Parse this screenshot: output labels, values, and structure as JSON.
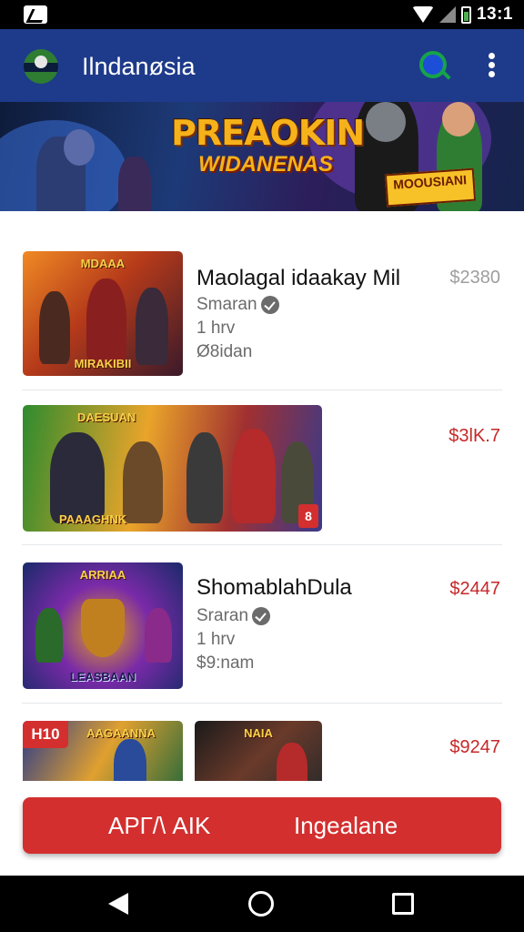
{
  "status_bar": {
    "time": "13:1",
    "icons": [
      "notification-icon",
      "wifi-icon",
      "signal-icon",
      "battery-icon"
    ]
  },
  "app_bar": {
    "title": "Ilndanøsia",
    "icons": [
      "app-logo",
      "search-icon",
      "more-vert-icon"
    ]
  },
  "hero": {
    "title": "PREAOKIN",
    "subtitle": "WIDANENAS",
    "badge": "MOOUSIANI"
  },
  "items": [
    {
      "title": "Maolagal idaakay Mil",
      "seller": "Smaran",
      "time": "1 hrv",
      "location": "Ø8idan",
      "price": "$2380",
      "price_color": "#9e9e9e",
      "thumb_top": "MDAAA",
      "thumb_bottom": "MIRAKIBII"
    },
    {
      "title": "",
      "seller": "",
      "time": "",
      "location": "",
      "price": "$3lK.7",
      "price_color": "#c62828",
      "thumb_top": "DAESUAN",
      "thumb_bottom": "PAAAGHNK",
      "corner_badge": "8"
    },
    {
      "title": "ShomablahDula",
      "seller": "Sraran",
      "time": "1 hrv",
      "location": "$9:nam",
      "price": "$2447",
      "price_color": "#c62828",
      "thumb_top": "ARRIAA",
      "thumb_bottom": "LEASBAAN"
    },
    {
      "title": "",
      "seller": "",
      "time": "",
      "location": "",
      "price": "$9247",
      "price_color": "#c62828",
      "thumb_top": "AAGAANNA",
      "thumb_top_right": "NAIA",
      "hot_badge": "H10"
    }
  ],
  "cta": {
    "left_label": "APГ/\\ AIK",
    "right_label": "Ingealane",
    "color": "#d32f2f"
  },
  "nav_bar": {
    "icons": [
      "back-icon",
      "home-icon",
      "recents-icon"
    ]
  },
  "colors": {
    "app_bar": "#1e3a8a",
    "accent_red": "#d32f2f"
  }
}
